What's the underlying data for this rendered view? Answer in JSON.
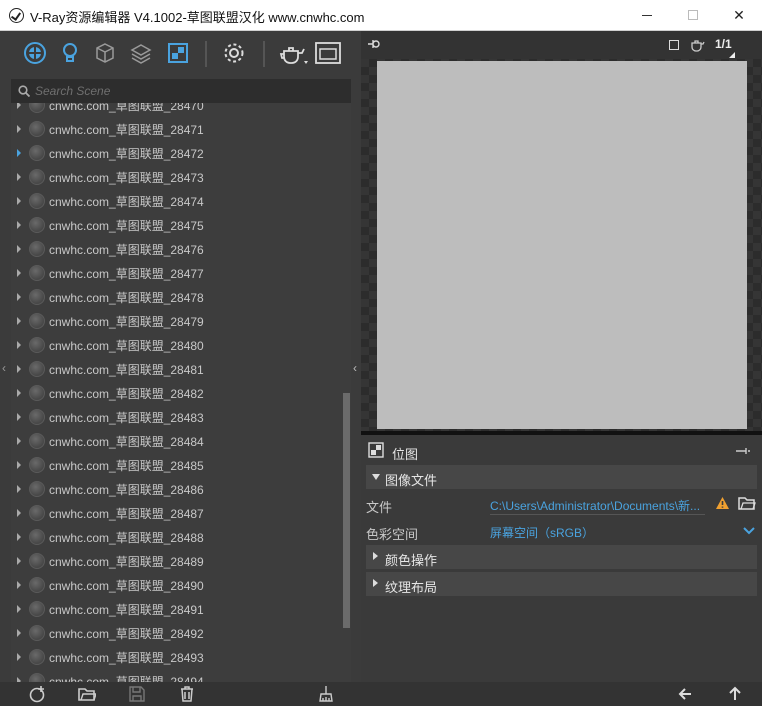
{
  "window": {
    "title": "V-Ray资源编辑器 V4.1002-草图联盟汉化 www.cnwhc.com",
    "minimize_glyph": "",
    "close_glyph": "✕"
  },
  "toolbar": {
    "icons": [
      "materials-icon",
      "lights-icon",
      "geometry-icon",
      "render-elements-icon",
      "textures-icon",
      "settings-icon",
      "render-teapot-icon",
      "frame-buffer-icon"
    ]
  },
  "search": {
    "placeholder": "Search Scene"
  },
  "scene_list": {
    "items": [
      {
        "label": "cnwhc.com_草图联盟_28470",
        "active": false
      },
      {
        "label": "cnwhc.com_草图联盟_28471",
        "active": false
      },
      {
        "label": "cnwhc.com_草图联盟_28472",
        "active": true
      },
      {
        "label": "cnwhc.com_草图联盟_28473",
        "active": false
      },
      {
        "label": "cnwhc.com_草图联盟_28474",
        "active": false
      },
      {
        "label": "cnwhc.com_草图联盟_28475",
        "active": false
      },
      {
        "label": "cnwhc.com_草图联盟_28476",
        "active": false
      },
      {
        "label": "cnwhc.com_草图联盟_28477",
        "active": false
      },
      {
        "label": "cnwhc.com_草图联盟_28478",
        "active": false
      },
      {
        "label": "cnwhc.com_草图联盟_28479",
        "active": false
      },
      {
        "label": "cnwhc.com_草图联盟_28480",
        "active": false
      },
      {
        "label": "cnwhc.com_草图联盟_28481",
        "active": false
      },
      {
        "label": "cnwhc.com_草图联盟_28482",
        "active": false
      },
      {
        "label": "cnwhc.com_草图联盟_28483",
        "active": false
      },
      {
        "label": "cnwhc.com_草图联盟_28484",
        "active": false
      },
      {
        "label": "cnwhc.com_草图联盟_28485",
        "active": false
      },
      {
        "label": "cnwhc.com_草图联盟_28486",
        "active": false
      },
      {
        "label": "cnwhc.com_草图联盟_28487",
        "active": false
      },
      {
        "label": "cnwhc.com_草图联盟_28488",
        "active": false
      },
      {
        "label": "cnwhc.com_草图联盟_28489",
        "active": false
      },
      {
        "label": "cnwhc.com_草图联盟_28490",
        "active": false
      },
      {
        "label": "cnwhc.com_草图联盟_28491",
        "active": false
      },
      {
        "label": "cnwhc.com_草图联盟_28492",
        "active": false
      },
      {
        "label": "cnwhc.com_草图联盟_28493",
        "active": false
      },
      {
        "label": "cnwhc.com_草图联盟_28494",
        "active": false
      }
    ]
  },
  "preview": {
    "ratio_label": "1/1"
  },
  "properties": {
    "title": "位图",
    "sections": {
      "image_file": "图像文件",
      "color_ops": "颜色操作",
      "texture_layout": "纹理布局"
    },
    "fields": {
      "file_label": "文件",
      "file_value": "C:\\Users\\Administrator\\Documents\\新...",
      "colorspace_label": "色彩空间",
      "colorspace_value": "屏幕空间（sRGB）"
    }
  },
  "colors": {
    "accent": "#4aa3df",
    "warning": "#f0a030",
    "preview_gray": "#bdbdbd"
  }
}
